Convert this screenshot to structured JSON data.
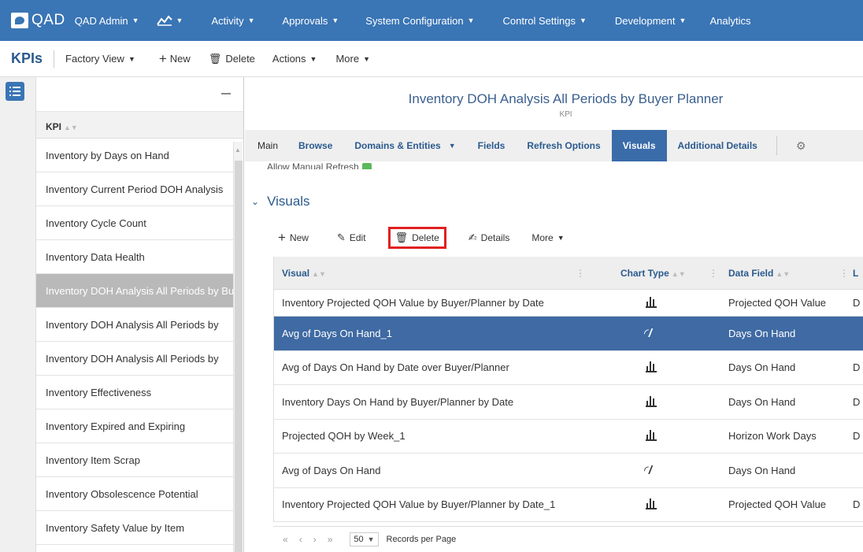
{
  "topbar": {
    "brand": "QAD",
    "menus": [
      "QAD Admin",
      "Activity",
      "Approvals",
      "System Configuration",
      "Control Settings",
      "Development",
      "Analytics"
    ]
  },
  "subbar": {
    "title": "KPIs",
    "view": "Factory View",
    "new": "New",
    "delete": "Delete",
    "actions": "Actions",
    "more": "More"
  },
  "list": {
    "header": "KPI",
    "items": [
      "Inventory by Days on Hand",
      "Inventory Current Period DOH Analysis",
      "Inventory Cycle Count",
      "Inventory Data Health",
      "Inventory DOH Analysis All Periods by Buyer Planner",
      "Inventory DOH Analysis All Periods by",
      "Inventory DOH Analysis All Periods by",
      "Inventory Effectiveness",
      "Inventory Expired and Expiring",
      "Inventory Item Scrap",
      "Inventory Obsolescence Potential",
      "Inventory Safety Value by Item"
    ]
  },
  "detail": {
    "title": "Inventory DOH Analysis All Periods by Buyer Planner",
    "subtitle": "KPI",
    "tabs": [
      "Main",
      "Browse",
      "Domains & Entities",
      "Fields",
      "Refresh Options",
      "Visuals",
      "Additional Details"
    ],
    "cut_text": "Allow Manual Refresh",
    "section": "Visuals",
    "toolbar": {
      "new": "New",
      "edit": "Edit",
      "delete": "Delete",
      "details": "Details",
      "more": "More"
    },
    "columns": {
      "visual": "Visual",
      "chart_type": "Chart Type",
      "data_field": "Data Field",
      "last": "L"
    },
    "rows": [
      {
        "visual": "Inventory Projected QOH Value by Buyer/Planner by Date",
        "chart": "bar",
        "field": "Projected QOH Value",
        "last": "D"
      },
      {
        "visual": "Avg of Days On Hand_1",
        "chart": "gauge",
        "field": "Days On Hand",
        "last": ""
      },
      {
        "visual": "Avg of Days On Hand by Date over Buyer/Planner",
        "chart": "bar",
        "field": "Days On Hand",
        "last": "D"
      },
      {
        "visual": "Inventory Days On Hand by Buyer/Planner by Date",
        "chart": "bar",
        "field": "Days On Hand",
        "last": "D"
      },
      {
        "visual": "Projected QOH by Week_1",
        "chart": "bar",
        "field": "Horizon Work Days",
        "last": "D"
      },
      {
        "visual": "Avg of Days On Hand",
        "chart": "gauge",
        "field": "Days On Hand",
        "last": ""
      },
      {
        "visual": "Inventory Projected QOH Value by Buyer/Planner by Date_1",
        "chart": "bar",
        "field": "Projected QOH Value",
        "last": "D"
      }
    ],
    "pager": {
      "page_size": "50",
      "records_label": "Records per Page"
    }
  }
}
